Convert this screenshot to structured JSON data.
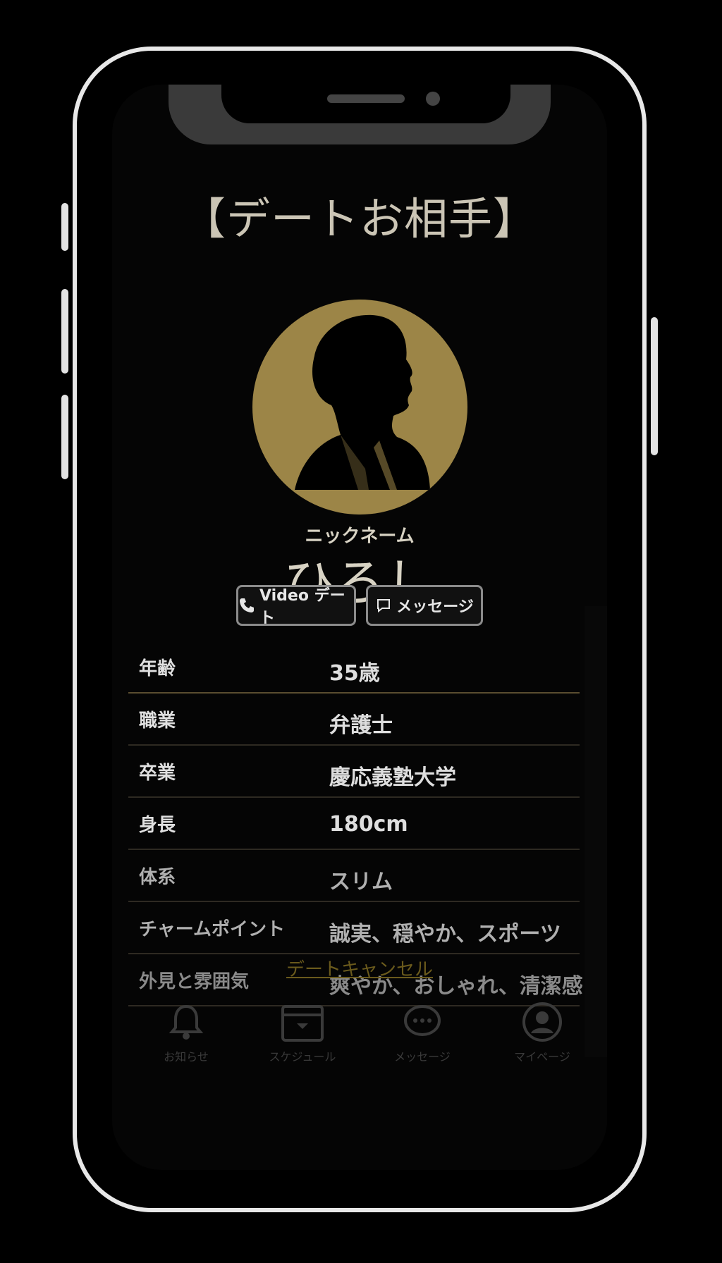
{
  "title": "【デートお相手】",
  "nickname_label": "ニックネーム",
  "nickname": "ひろし",
  "buttons": {
    "video": "Video デート",
    "message": "メッセージ"
  },
  "profile": [
    {
      "key": "年齢",
      "value": "35歳"
    },
    {
      "key": "職業",
      "value": "弁護士"
    },
    {
      "key": "卒業",
      "value": "慶応義塾大学"
    },
    {
      "key": "身長",
      "value": "180cm"
    },
    {
      "key": "体系",
      "value": "スリム"
    },
    {
      "key": "チャームポイント",
      "value": "誠実、穏やか、スポーツ"
    },
    {
      "key": "外見と雰囲気",
      "value": "爽やか、おしゃれ、清潔感"
    }
  ],
  "cancel_link": "デートキャンセル",
  "nav": [
    {
      "label": "お知らせ",
      "icon": "bell-icon"
    },
    {
      "label": "スケジュール",
      "icon": "calendar-icon"
    },
    {
      "label": "メッセージ",
      "icon": "chat-icon"
    },
    {
      "label": "マイページ",
      "icon": "user-icon"
    }
  ],
  "colors": {
    "accent_gold": "#9c8547",
    "background": "#050505",
    "frame": "#e8e8e8"
  }
}
